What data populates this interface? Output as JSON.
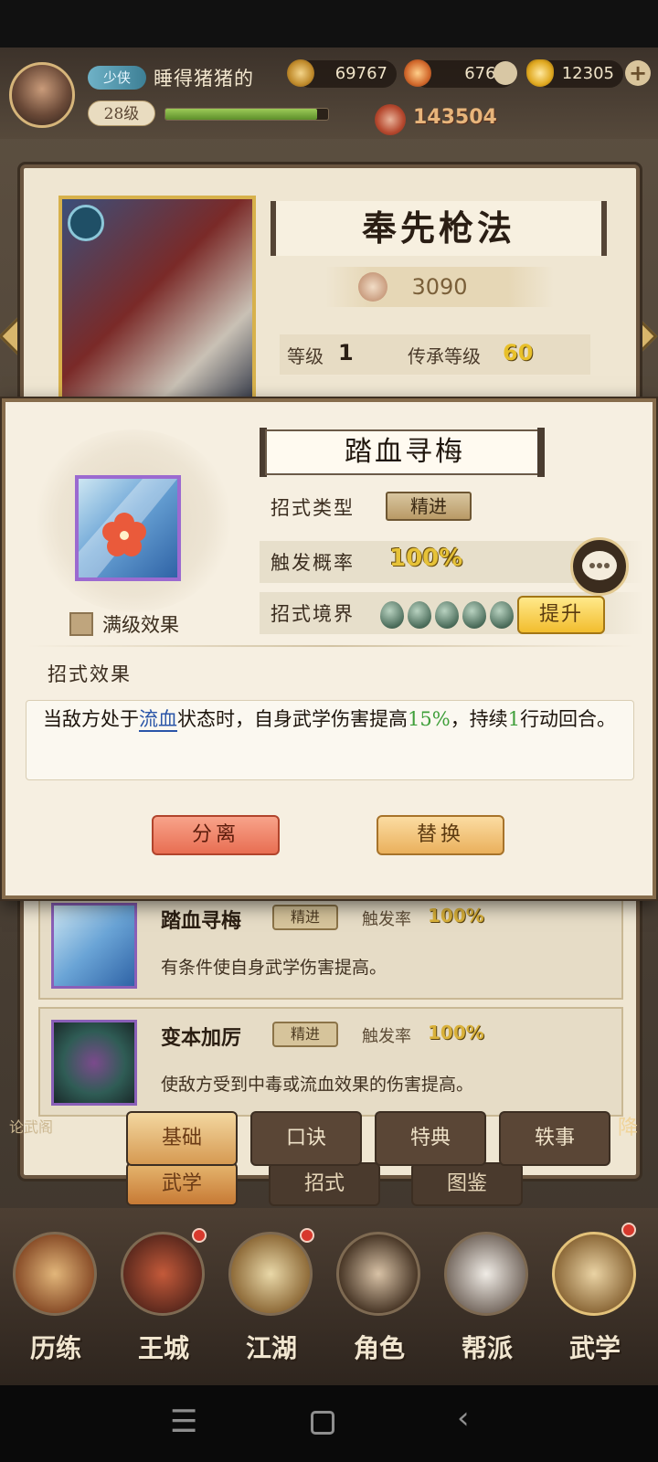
{
  "header": {
    "title_badge": "少侠",
    "player_name": "睡得猪猪的",
    "level": "28级",
    "exp_fraction": 0.93,
    "copper": "69767",
    "gem": "6765",
    "gold": "12305",
    "power": "143504"
  },
  "card": {
    "skill_name": "奉先枪法",
    "score": "3090",
    "level_label": "等级",
    "level_value": "1",
    "inherit_label": "传承等级",
    "inherit_value": "60",
    "rows": [
      {
        "name": "踏血寻梅",
        "tag": "精进",
        "rate_label": "触发率",
        "rate": "100%",
        "desc": "有条件使自身武学伤害提高。"
      },
      {
        "name": "变本加厉",
        "tag": "精进",
        "rate_label": "触发率",
        "rate": "100%",
        "desc": "使敌方受到中毒或流血效果的伤害提高。"
      }
    ]
  },
  "tabs_top": [
    "基础",
    "口诀",
    "特典",
    "轶事"
  ],
  "tabs_bottom": [
    "武学",
    "招式",
    "图鉴"
  ],
  "side_left": "论武阁",
  "side_right": "降",
  "main_nav": [
    "历练",
    "王城",
    "江湖",
    "角色",
    "帮派",
    "武学"
  ],
  "modal": {
    "title": "踏血寻梅",
    "type_label": "招式类型",
    "type_value": "精进",
    "rate_label": "触发概率",
    "rate_value": "100%",
    "realm_label": "招式境界",
    "realm_count": 5,
    "upgrade_label": "提升",
    "max_level_label": "满级效果",
    "effect_head": "招式效果",
    "effect_pre": "当敌方处于",
    "effect_link": "流血",
    "effect_mid": "状态时，自身武学伤害提高",
    "effect_num1": "15%",
    "effect_mid2": "，持续",
    "effect_num2": "1",
    "effect_post": "行动回合。",
    "btn_separate": "分离",
    "btn_replace": "替换"
  },
  "colors": {
    "accent_gold": "#e6c238",
    "link_blue": "#2a55a8",
    "green": "#3f9f3a"
  },
  "icons": [
    "avatar",
    "copper-coin-icon",
    "gem-icon",
    "gold-ingot-icon",
    "plus-icon",
    "power-icon",
    "chat-icon",
    "jade-icon"
  ]
}
